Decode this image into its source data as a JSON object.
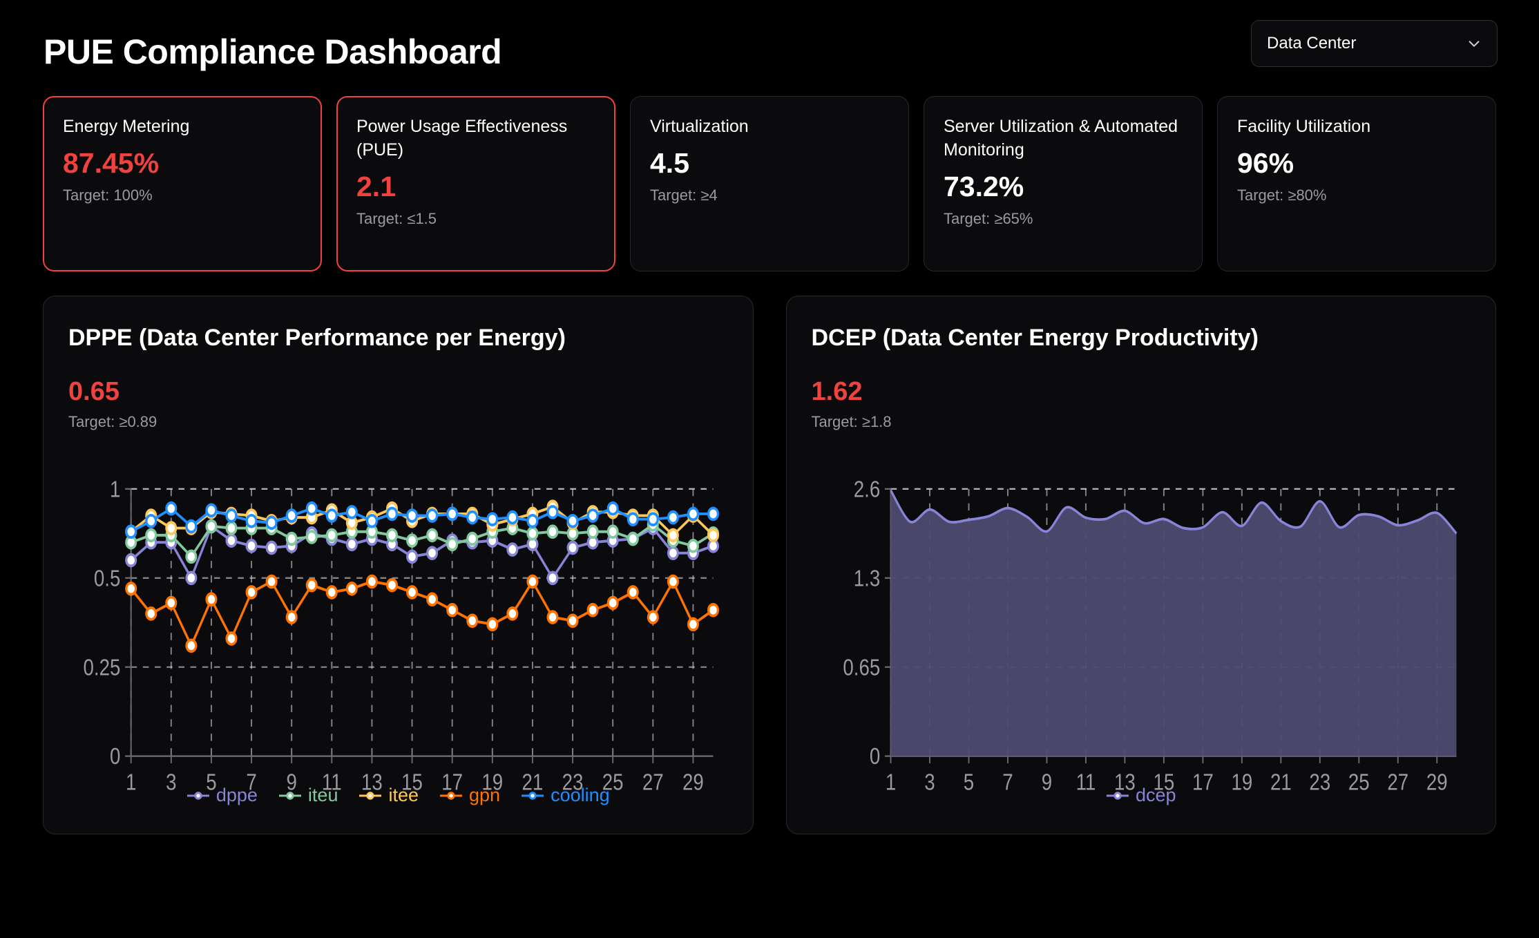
{
  "header": {
    "title": "PUE Compliance Dashboard",
    "selector": {
      "value": "Data Center",
      "icon": "chevron-down-icon",
      "options": [
        "Data Center"
      ]
    }
  },
  "colors": {
    "background": "#000000",
    "card_background": "#0b0b0d",
    "card_border": "#27272b",
    "alert": "#f0423f",
    "text_primary": "#ffffff",
    "text_muted": "#9a9a9f",
    "grid": "#cfcfd4",
    "dppe": "#8884d8",
    "iteu": "#82ca9d",
    "itee": "#ffc658",
    "gpn": "#ff7300",
    "cooling": "#1e90ff",
    "dcep": "#8884d8",
    "dcep_fill": "#4e4b70"
  },
  "kpis": [
    {
      "title": "Energy Metering",
      "value": "87.45%",
      "target": "Target: 100%",
      "alert": true
    },
    {
      "title": "Power Usage Effectiveness (PUE)",
      "value": "2.1",
      "target": "Target: ≤1.5",
      "alert": true
    },
    {
      "title": "Virtualization",
      "value": "4.5",
      "target": "Target: ≥4",
      "alert": false
    },
    {
      "title": "Server Utilization & Automated Monitoring",
      "value": "73.2%",
      "target": "Target: ≥65%",
      "alert": false
    },
    {
      "title": "Facility Utilization",
      "value": "96%",
      "target": "Target: ≥80%",
      "alert": false
    }
  ],
  "panels": [
    {
      "title": "DPPE (Data Center Performance per Energy)",
      "value": "0.65",
      "target": "Target: ≥0.89"
    },
    {
      "title": "DCEP (Data Center Energy Productivity)",
      "value": "1.62",
      "target": "Target: ≥1.8"
    }
  ],
  "chart_data": [
    {
      "id": "dppe-chart",
      "type": "line",
      "title": "DPPE (Data Center Performance per Energy)",
      "xlabel": "",
      "ylabel": "",
      "x": [
        1,
        2,
        3,
        4,
        5,
        6,
        7,
        8,
        9,
        10,
        11,
        12,
        13,
        14,
        15,
        16,
        17,
        18,
        19,
        20,
        21,
        22,
        23,
        24,
        25,
        26,
        27,
        28,
        29,
        30
      ],
      "xticks": [
        1,
        3,
        5,
        7,
        9,
        11,
        13,
        15,
        17,
        19,
        21,
        23,
        25,
        27,
        29
      ],
      "yticks": [
        0,
        0.25,
        0.5,
        1
      ],
      "ylim": [
        0,
        1
      ],
      "grid": true,
      "legend_position": "bottom",
      "series": [
        {
          "name": "dppe",
          "color": "#8884d8",
          "values": [
            0.6,
            0.7,
            0.7,
            0.5,
            0.79,
            0.71,
            0.68,
            0.67,
            0.68,
            0.75,
            0.72,
            0.69,
            0.72,
            0.69,
            0.62,
            0.64,
            0.71,
            0.7,
            0.71,
            0.66,
            0.69,
            0.5,
            0.67,
            0.7,
            0.71,
            0.72,
            0.78,
            0.64,
            0.64,
            0.68
          ]
        },
        {
          "name": "iteu",
          "color": "#82ca9d",
          "values": [
            0.7,
            0.74,
            0.74,
            0.62,
            0.79,
            0.78,
            0.78,
            0.78,
            0.72,
            0.73,
            0.74,
            0.76,
            0.76,
            0.74,
            0.71,
            0.74,
            0.69,
            0.72,
            0.76,
            0.78,
            0.75,
            0.76,
            0.75,
            0.76,
            0.76,
            0.72,
            0.8,
            0.71,
            0.68,
            0.75
          ]
        },
        {
          "name": "itee",
          "color": "#ffc658",
          "values": [
            0.76,
            0.85,
            0.78,
            0.78,
            0.87,
            0.86,
            0.85,
            0.82,
            0.84,
            0.84,
            0.88,
            0.81,
            0.84,
            0.89,
            0.82,
            0.86,
            0.86,
            0.86,
            0.8,
            0.83,
            0.86,
            0.9,
            0.81,
            0.87,
            0.87,
            0.85,
            0.85,
            0.74,
            0.85,
            0.74
          ]
        },
        {
          "name": "gpn",
          "color": "#ff7300",
          "values": [
            0.47,
            0.4,
            0.43,
            0.31,
            0.44,
            0.33,
            0.46,
            0.49,
            0.39,
            0.48,
            0.46,
            0.47,
            0.49,
            0.48,
            0.46,
            0.44,
            0.41,
            0.38,
            0.37,
            0.4,
            0.49,
            0.39,
            0.38,
            0.41,
            0.43,
            0.46,
            0.39,
            0.49,
            0.37,
            0.41
          ]
        },
        {
          "name": "cooling",
          "color": "#1e90ff",
          "values": [
            0.76,
            0.82,
            0.89,
            0.79,
            0.88,
            0.85,
            0.82,
            0.81,
            0.85,
            0.89,
            0.85,
            0.87,
            0.82,
            0.86,
            0.85,
            0.85,
            0.86,
            0.84,
            0.83,
            0.84,
            0.82,
            0.87,
            0.82,
            0.85,
            0.89,
            0.83,
            0.83,
            0.84,
            0.86,
            0.86
          ]
        }
      ],
      "legend": [
        {
          "label": "dppe",
          "color": "#8884d8"
        },
        {
          "label": "iteu",
          "color": "#82ca9d"
        },
        {
          "label": "itee",
          "color": "#ffc658"
        },
        {
          "label": "gpn",
          "color": "#ff7300"
        },
        {
          "label": "cooling",
          "color": "#1e90ff"
        }
      ]
    },
    {
      "id": "dcep-chart",
      "type": "area",
      "title": "DCEP (Data Center Energy Productivity)",
      "xlabel": "",
      "ylabel": "",
      "x": [
        1,
        2,
        3,
        4,
        5,
        6,
        7,
        8,
        9,
        10,
        11,
        12,
        13,
        14,
        15,
        16,
        17,
        18,
        19,
        20,
        21,
        22,
        23,
        24,
        25,
        26,
        27,
        28,
        29,
        30
      ],
      "xticks": [
        1,
        3,
        5,
        7,
        9,
        11,
        13,
        15,
        17,
        19,
        21,
        23,
        25,
        27,
        29
      ],
      "yticks": [
        0,
        0.65,
        1.3,
        2.6
      ],
      "ylim": [
        0,
        2.6
      ],
      "grid": true,
      "legend_position": "bottom",
      "series": [
        {
          "name": "dcep",
          "color": "#8884d8",
          "values": [
            2.58,
            2.12,
            2.3,
            2.12,
            2.15,
            2.2,
            2.32,
            2.19,
            1.98,
            2.33,
            2.18,
            2.16,
            2.28,
            2.1,
            2.16,
            2.03,
            2.04,
            2.26,
            2.06,
            2.4,
            2.13,
            2.05,
            2.42,
            2.04,
            2.22,
            2.2,
            2.07,
            2.14,
            2.25,
            1.95
          ]
        }
      ],
      "legend": [
        {
          "label": "dcep",
          "color": "#8884d8"
        }
      ]
    }
  ]
}
